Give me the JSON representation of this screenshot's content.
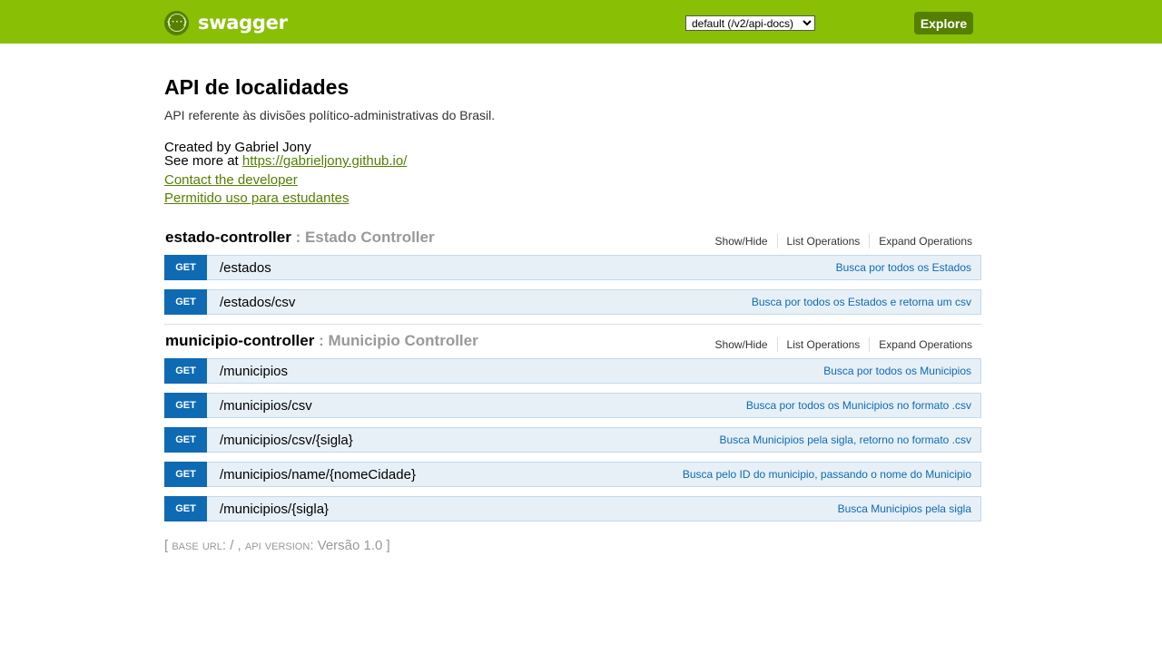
{
  "header": {
    "logo_text": "swagger",
    "logo_icon": "swagger-logo-icon",
    "api_select_value": "default (/v2/api-docs)",
    "explore_label": "Explore",
    "bar_color": "#89bf04"
  },
  "info": {
    "title": "API de localidades",
    "description": "API referente às divisões político-administrativas do Brasil.",
    "created_by": "Created by Gabriel Jony",
    "see_more_prefix": "See more at ",
    "see_more_link": "https://gabrieljony.github.io/",
    "contact_label": "Contact the developer",
    "license_label": "Permitido uso para estudantes"
  },
  "resources": [
    {
      "name": "estado-controller",
      "description": " : Estado Controller",
      "actions": [
        "Show/Hide",
        "List Operations",
        "Expand Operations"
      ],
      "operations": [
        {
          "method": "GET",
          "path": "/estados",
          "summary": "Busca por todos os Estados"
        },
        {
          "method": "GET",
          "path": "/estados/csv",
          "summary": "Busca por todos os Estados e retorna um csv"
        }
      ]
    },
    {
      "name": "municipio-controller",
      "description": " : Municipio Controller",
      "actions": [
        "Show/Hide",
        "List Operations",
        "Expand Operations"
      ],
      "operations": [
        {
          "method": "GET",
          "path": "/municipios",
          "summary": "Busca por todos os Municipios"
        },
        {
          "method": "GET",
          "path": "/municipios/csv",
          "summary": "Busca por todos os Municipios no formato .csv"
        },
        {
          "method": "GET",
          "path": "/municipios/csv/{sigla}",
          "summary": "Busca Municipios pela sigla, retorno no formato .csv"
        },
        {
          "method": "GET",
          "path": "/municipios/name/{nomeCidade}",
          "summary": "Busca pelo ID do municipio, passando o nome do Municipio"
        },
        {
          "method": "GET",
          "path": "/municipios/{sigla}",
          "summary": "Busca Municipios pela sigla"
        }
      ]
    }
  ],
  "footer": {
    "open": "[ ",
    "base_url_label": "base url",
    "base_url_value": ": / , ",
    "api_version_label": "api version",
    "api_version_value": ": Versão 1.0 ",
    "close": "]"
  },
  "colors": {
    "get_method": "#0f6ab4",
    "operation_bg": "#e7f0f7",
    "link": "#547f00"
  }
}
